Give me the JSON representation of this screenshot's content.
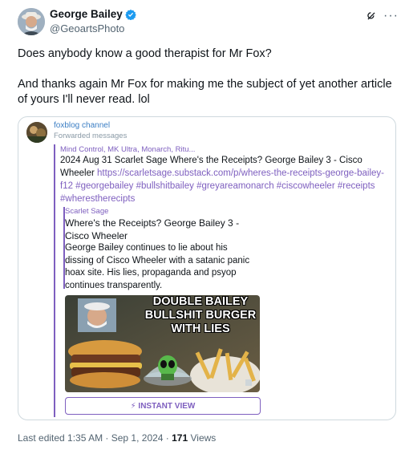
{
  "author": {
    "name": "George Bailey",
    "handle": "@GeoartsPhoto"
  },
  "tweet": {
    "line1": "Does anybody know a good therapist for Mr Fox?",
    "line2": "And thanks again Mr Fox for making me the subject of yet another article of yours I'll never read.  lol"
  },
  "card": {
    "channel_name": "foxblog channel",
    "channel_sub": "Forwarded messages",
    "forward_source": "Mind Control, MK Ultra, Monarch, Ritu...",
    "forward_text": "2024 Aug 31 Scarlet Sage Where's the Receipts? George Bailey 3 - Cisco Wheeler ",
    "forward_link": "https://scarletsage.substack.com/p/wheres-the-receipts-george-bailey-f12 #georgebailey #bullshitbailey #greyareamonarch #ciscowheeler #receipts #wherestherecipts",
    "inner_source": "Scarlet Sage",
    "inner_title": "Where's the Receipts? George Bailey 3 - Cisco Wheeler",
    "inner_body": "George Bailey continues to lie about his dissing of Cisco Wheeler with a satanic panic hoax site. His lies, propaganda and psyop continues transparently.",
    "image_caption": "DOUBLE BAILEY BULLSHIT BURGER WITH LIES",
    "instant_view": "⚡ INSTANT VIEW"
  },
  "footer": {
    "edited": "Last edited 1:35 AM · Sep 1, 2024 · ",
    "views_count": "171",
    "views_label": " Views"
  }
}
